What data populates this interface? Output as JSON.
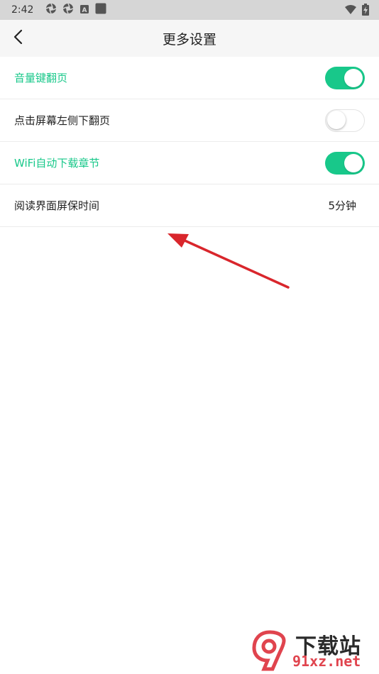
{
  "status_bar": {
    "time": "2:42",
    "left_icons": [
      "shutter-icon",
      "shutter-icon",
      "a-box-icon",
      "square-icon"
    ],
    "right_icons": [
      "wifi-icon",
      "battery-charging-icon"
    ]
  },
  "header": {
    "title": "更多设置",
    "back_icon": "chevron-left-icon"
  },
  "settings": [
    {
      "label": "音量键翻页",
      "control": "toggle",
      "state": "on"
    },
    {
      "label": "点击屏幕左侧下翻页",
      "control": "toggle",
      "state": "off"
    },
    {
      "label": "WiFi自动下载章节",
      "control": "toggle",
      "state": "on"
    },
    {
      "label": "阅读界面屏保时间",
      "control": "value",
      "value": "5分钟"
    }
  ],
  "colors": {
    "accent": "#18c88a",
    "annotation": "#d9262c",
    "status_bar_bg": "#d6d6d6",
    "header_bg": "#f6f6f6"
  },
  "watermark": {
    "text_main": "下载站",
    "text_url": "91xz.net"
  }
}
